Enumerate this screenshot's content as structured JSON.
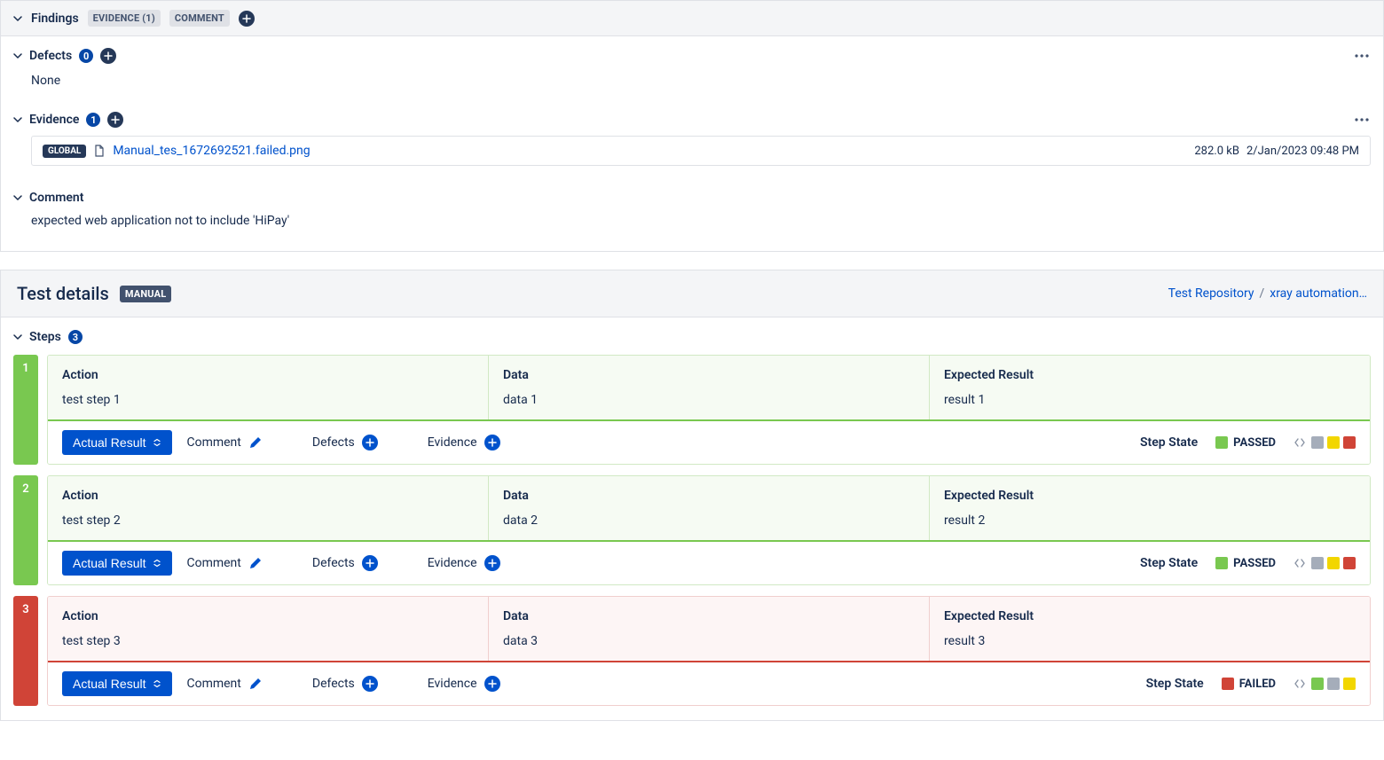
{
  "findings": {
    "title": "Findings",
    "evidenceBadge": "EVIDENCE (1)",
    "commentBadge": "COMMENT"
  },
  "defects": {
    "title": "Defects",
    "count": "0",
    "none": "None"
  },
  "evidence": {
    "title": "Evidence",
    "count": "1",
    "item": {
      "globalBadge": "GLOBAL",
      "filename": "Manual_tes_1672692521.failed.png",
      "size": "282.0 kB",
      "date": "2/Jan/2023 09:48 PM"
    }
  },
  "comment": {
    "title": "Comment",
    "text": "expected web application not to include 'HiPay'"
  },
  "testDetails": {
    "title": "Test details",
    "manualBadge": "MANUAL",
    "breadcrumbRepo": "Test Repository",
    "breadcrumbSep": "/",
    "breadcrumbPath": "xray automation…"
  },
  "steps": {
    "title": "Steps",
    "count": "3",
    "headers": {
      "action": "Action",
      "data": "Data",
      "expected": "Expected Result"
    },
    "actualResultBtn": "Actual Result",
    "commentLabel": "Comment",
    "defectsLabel": "Defects",
    "evidenceLabel": "Evidence",
    "stepStateLabel": "Step State",
    "passedText": "PASSED",
    "failedText": "FAILED",
    "items": [
      {
        "num": "1",
        "action": "test step 1",
        "data": "data 1",
        "expected": "result 1",
        "state": "PASSED"
      },
      {
        "num": "2",
        "action": "test step 2",
        "data": "data 2",
        "expected": "result 2",
        "state": "PASSED"
      },
      {
        "num": "3",
        "action": "test step 3",
        "data": "data 3",
        "expected": "result 3",
        "state": "FAILED"
      }
    ]
  }
}
